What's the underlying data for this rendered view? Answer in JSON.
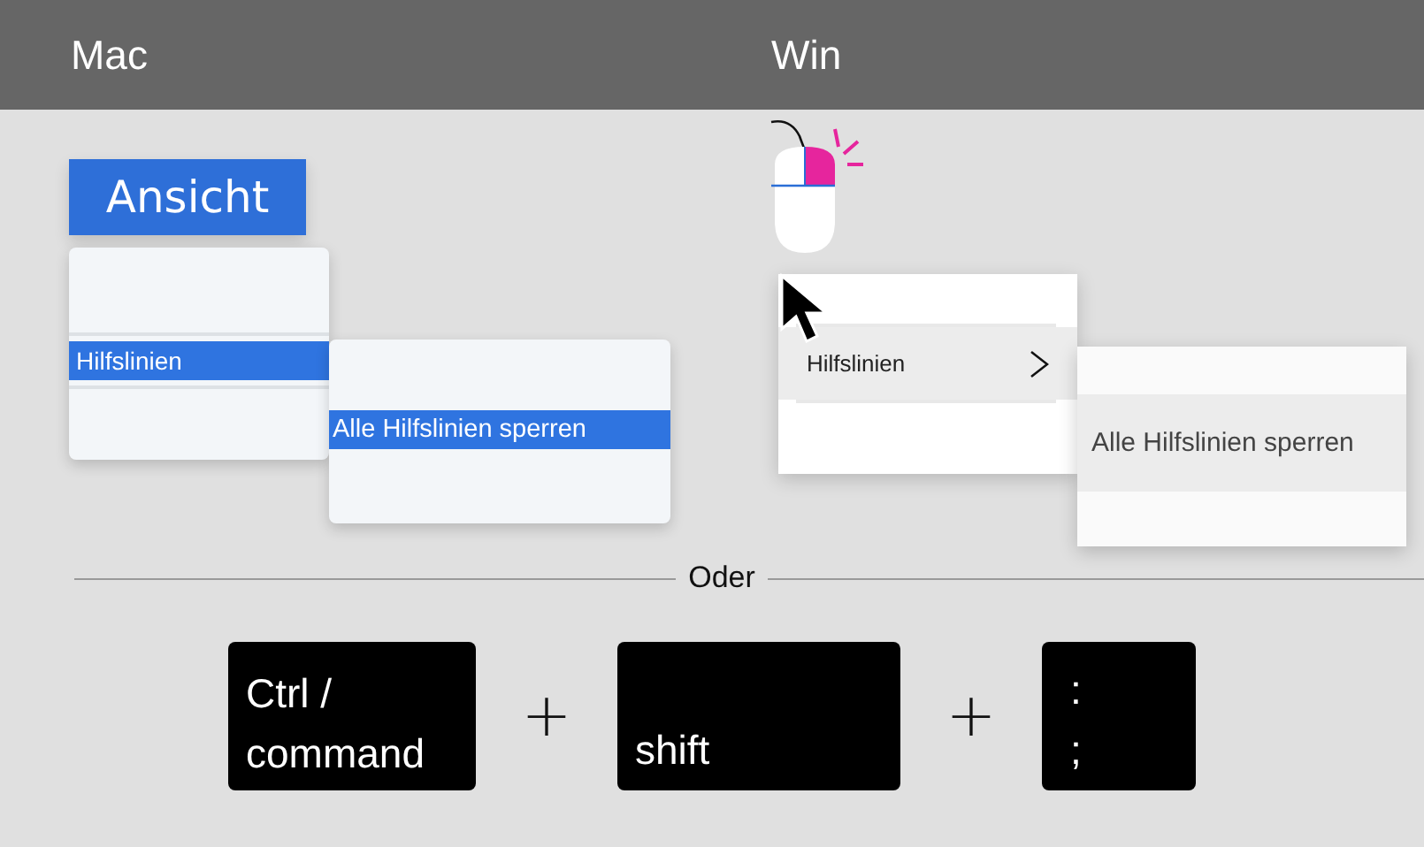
{
  "header": {
    "columns": [
      "Mac",
      "Win"
    ]
  },
  "mac": {
    "menu_title": "Ansicht",
    "menu_items": [
      {
        "label": "Hilfslinien",
        "selected": true
      }
    ],
    "submenu_items": [
      {
        "label": "Alle Hilfslinien sperren",
        "selected": true
      }
    ]
  },
  "win": {
    "menu_items": [
      {
        "label": "Hilfslinien",
        "selected": true,
        "has_submenu": true
      }
    ],
    "submenu_items": [
      {
        "label": "Alle Hilfslinien sperren",
        "selected": true
      }
    ]
  },
  "divider_label": "Oder",
  "shortcut": {
    "keys": [
      {
        "lines": [
          "Ctrl /",
          "command"
        ]
      },
      {
        "lines": [
          "shift"
        ]
      },
      {
        "lines": [
          ":",
          ";"
        ]
      }
    ],
    "joiners": [
      "+",
      "+"
    ]
  }
}
